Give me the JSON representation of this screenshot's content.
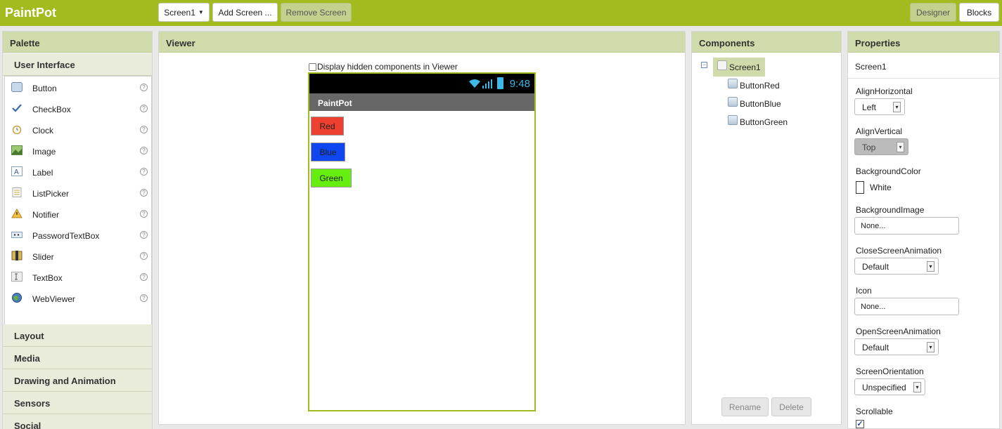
{
  "app": {
    "title": "PaintPot"
  },
  "toolbar": {
    "screen_select": "Screen1",
    "add_screen": "Add Screen ...",
    "remove_screen": "Remove Screen",
    "designer": "Designer",
    "blocks": "Blocks"
  },
  "palette": {
    "title": "Palette",
    "open_section": "User Interface",
    "items": [
      {
        "label": "Button",
        "icon": "button-icon"
      },
      {
        "label": "CheckBox",
        "icon": "checkbox-icon"
      },
      {
        "label": "Clock",
        "icon": "clock-icon"
      },
      {
        "label": "Image",
        "icon": "image-icon"
      },
      {
        "label": "Label",
        "icon": "label-icon"
      },
      {
        "label": "ListPicker",
        "icon": "listpicker-icon"
      },
      {
        "label": "Notifier",
        "icon": "notifier-icon"
      },
      {
        "label": "PasswordTextBox",
        "icon": "passwordtextbox-icon"
      },
      {
        "label": "Slider",
        "icon": "slider-icon"
      },
      {
        "label": "TextBox",
        "icon": "textbox-icon"
      },
      {
        "label": "WebViewer",
        "icon": "webviewer-icon"
      }
    ],
    "help_glyph": "?",
    "sections": [
      "Layout",
      "Media",
      "Drawing and Animation",
      "Sensors",
      "Social"
    ]
  },
  "viewer": {
    "title": "Viewer",
    "hidden_checkbox_label": "Display hidden components in Viewer",
    "phone": {
      "time": "9:48",
      "screen_title": "PaintPot",
      "buttons": [
        {
          "label": "Red",
          "color": "#ee4030"
        },
        {
          "label": "Blue",
          "color": "#1046f0"
        },
        {
          "label": "Green",
          "color": "#66ee10"
        }
      ]
    }
  },
  "components": {
    "title": "Components",
    "collapse_glyph": "−",
    "root": "Screen1",
    "children": [
      "ButtonRed",
      "ButtonBlue",
      "ButtonGreen"
    ],
    "rename": "Rename",
    "delete": "Delete"
  },
  "properties": {
    "title": "Properties",
    "component": "Screen1",
    "align_horizontal_label": "AlignHorizontal",
    "align_horizontal_value": "Left",
    "align_vertical_label": "AlignVertical",
    "align_vertical_value": "Top",
    "background_color_label": "BackgroundColor",
    "background_color_value": "White",
    "background_image_label": "BackgroundImage",
    "background_image_value": "None...",
    "close_anim_label": "CloseScreenAnimation",
    "close_anim_value": "Default",
    "icon_label": "Icon",
    "icon_value": "None...",
    "open_anim_label": "OpenScreenAnimation",
    "open_anim_value": "Default",
    "orientation_label": "ScreenOrientation",
    "orientation_value": "Unspecified",
    "scrollable_label": "Scrollable",
    "scrollable_checked": true,
    "dropdown_glyph": "▾",
    "check_glyph": "✓"
  },
  "colors": {
    "brand": "#a4bb1f",
    "panel_header": "#d0dbab"
  }
}
